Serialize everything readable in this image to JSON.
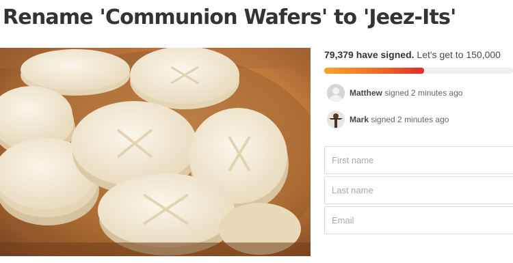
{
  "petition": {
    "title": "Rename 'Communion Wafers' to 'Jeez-Its'"
  },
  "photo": {
    "alt_icon": "communion-wafers-image"
  },
  "signatures": {
    "count_label": "79,379 have signed.",
    "goal_label": "Let's get to 150,000",
    "signed": 79379,
    "goal": 150000,
    "progress_fraction": 0.529
  },
  "signers": [
    {
      "name": "Matthew",
      "action": "signed 2 minutes ago",
      "avatar": "default-avatar-icon"
    },
    {
      "name": "Mark",
      "action": "signed 2 minutes ago",
      "avatar": "photo-avatar-icon"
    }
  ],
  "form": {
    "first_name_placeholder": "First name",
    "last_name_placeholder": "Last name",
    "email_placeholder": "Email",
    "first_name_value": "",
    "last_name_value": "",
    "email_value": ""
  },
  "colors": {
    "progress_start": "#f7a32a",
    "progress_end": "#e02b2b",
    "progress_track": "#efefef",
    "bowl": "#c4874a",
    "wafer": "#f3ead6"
  }
}
